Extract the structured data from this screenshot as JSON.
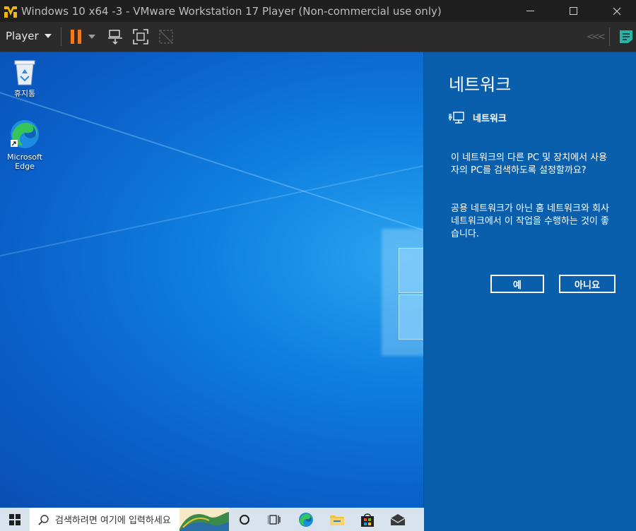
{
  "window": {
    "title": "Windows 10 x64 -3 - VMware Workstation 17 Player (Non-commercial use only)"
  },
  "toolbar": {
    "player_label": "Player"
  },
  "desktop": {
    "icons": [
      {
        "label": "휴지통"
      },
      {
        "label": "Microsoft Edge"
      }
    ]
  },
  "flyout": {
    "title": "네트워크",
    "network_name": "네트워크",
    "question": "이 네트워크의 다른 PC 및 장치에서 사용자의 PC를 검색하도록 설정할까요?",
    "advice": "공용 네트워크가 아닌 홈 네트워크와 회사 네트워크에서 이 작업을 수행하는 것이 좋습니다.",
    "yes_label": "예",
    "no_label": "아니요"
  },
  "taskbar": {
    "search_placeholder": "검색하려면 여기에 입력하세요"
  },
  "colors": {
    "accent_orange": "#f07a1f",
    "flyout_bg": "#0a5fad",
    "titlebar_bg": "#1f1f1f"
  }
}
